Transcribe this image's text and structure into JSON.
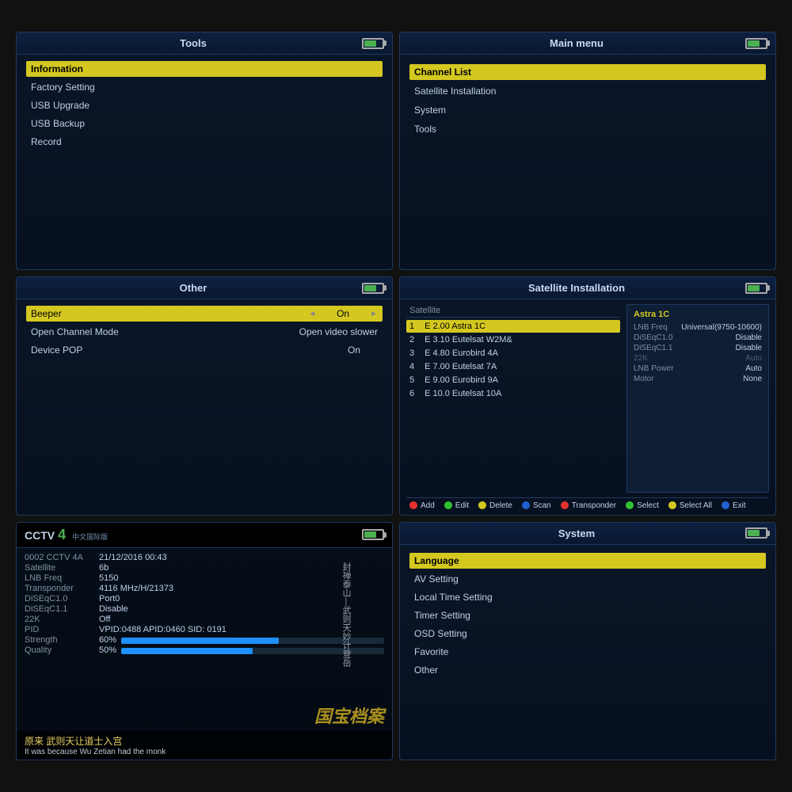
{
  "panels": {
    "tools": {
      "title": "Tools",
      "menu_items": [
        {
          "label": "Information",
          "selected": true
        },
        {
          "label": "Factory Setting",
          "selected": false
        },
        {
          "label": "USB Upgrade",
          "selected": false
        },
        {
          "label": "USB Backup",
          "selected": false
        },
        {
          "label": "Record",
          "selected": false
        }
      ]
    },
    "mainmenu": {
      "title": "Main menu",
      "menu_items": [
        {
          "label": "Channel List",
          "selected": true
        },
        {
          "label": "Satellite Installation",
          "selected": false
        },
        {
          "label": "System",
          "selected": false
        },
        {
          "label": "Tools",
          "selected": false
        }
      ]
    },
    "other": {
      "title": "Other",
      "settings": [
        {
          "label": "Beeper",
          "value": "On",
          "selected": true,
          "has_arrows": true
        },
        {
          "label": "Open Channel Mode",
          "value": "Open video slower",
          "selected": false,
          "has_arrows": false
        },
        {
          "label": "Device POP",
          "value": "On",
          "selected": false,
          "has_arrows": false
        }
      ]
    },
    "satellite": {
      "title": "Satellite Installation",
      "list_header": "Satellite",
      "satellites": [
        {
          "num": "1",
          "dir": "E",
          "deg": "2.00",
          "name": "Astra 1C",
          "selected": true
        },
        {
          "num": "2",
          "dir": "E",
          "deg": "3.10",
          "name": "Eutelsat W2M&",
          "selected": false
        },
        {
          "num": "3",
          "dir": "E",
          "deg": "4.80",
          "name": "Eurobird 4A",
          "selected": false
        },
        {
          "num": "4",
          "dir": "E",
          "deg": "7.00",
          "name": "Eutelsat 7A",
          "selected": false
        },
        {
          "num": "5",
          "dir": "E",
          "deg": "9.00",
          "name": "Eurobird 9A",
          "selected": false
        },
        {
          "num": "6",
          "dir": "E",
          "deg": "10.0",
          "name": "Eutelsat 10A",
          "selected": false
        }
      ],
      "sat_info": {
        "title": "Astra 1C",
        "rows": [
          {
            "key": "LNB Freq",
            "value": "Universal(9750-10600)",
            "dimmed": false
          },
          {
            "key": "DiSEqC1.0",
            "value": "Disable",
            "dimmed": false
          },
          {
            "key": "DiSEqC1.1",
            "value": "Disable",
            "dimmed": false
          },
          {
            "key": "22K",
            "value": "Auto",
            "dimmed": true
          },
          {
            "key": "LNB Power",
            "value": "Auto",
            "dimmed": false
          },
          {
            "key": "Motor",
            "value": "None",
            "dimmed": false
          }
        ]
      },
      "buttons": [
        {
          "color": "red",
          "label": "Add"
        },
        {
          "color": "green",
          "label": "Edit"
        },
        {
          "color": "yellow",
          "label": "Delete"
        },
        {
          "color": "blue",
          "label": "Scan"
        },
        {
          "color": "red",
          "label": "Transponder"
        },
        {
          "color": "green",
          "label": "Select"
        },
        {
          "color": "yellow",
          "label": "Select All"
        },
        {
          "color": "blue",
          "label": "Exit"
        }
      ]
    },
    "system": {
      "title": "System",
      "menu_items": [
        {
          "label": "Language",
          "selected": true
        },
        {
          "label": "AV Setting",
          "selected": false
        },
        {
          "label": "Local Time Setting",
          "selected": false
        },
        {
          "label": "Timer Setting",
          "selected": false
        },
        {
          "label": "OSD Setting",
          "selected": false
        },
        {
          "label": "Favorite",
          "selected": false
        },
        {
          "label": "Other",
          "selected": false
        }
      ]
    },
    "cctv": {
      "channel_name": "CCTV",
      "channel_num": "4",
      "channel_subtitle": "中文国际版",
      "info_rows": [
        {
          "label": "0002 CCTV 4A",
          "value": "21/12/2016  00:43"
        },
        {
          "label": "Satellite",
          "value": "6b"
        },
        {
          "label": "LNB Freq",
          "value": "5150"
        },
        {
          "label": "Transponder",
          "value": "4116 MHz/H/21373"
        },
        {
          "label": "DiSEqC1.0",
          "value": "Port0"
        },
        {
          "label": "DiSEqC1.1",
          "value": "Disable"
        },
        {
          "label": "22K",
          "value": "Off"
        },
        {
          "label": "PID",
          "value": "VPID:0488 APID:0460 SID: 0191"
        }
      ],
      "strength_label": "Strength",
      "strength_value": "60%",
      "quality_label": "Quality",
      "quality_value": "50%",
      "strength_pct": 60,
      "quality_pct": 50,
      "subtitle_cn": "原来 武则天让道士入宫",
      "subtitle_en": "It was because Wu Zetian had the monk",
      "watermark": "国宝档案",
      "chinese_vertical": "封禅泰山—武则天妙计登岳"
    }
  }
}
